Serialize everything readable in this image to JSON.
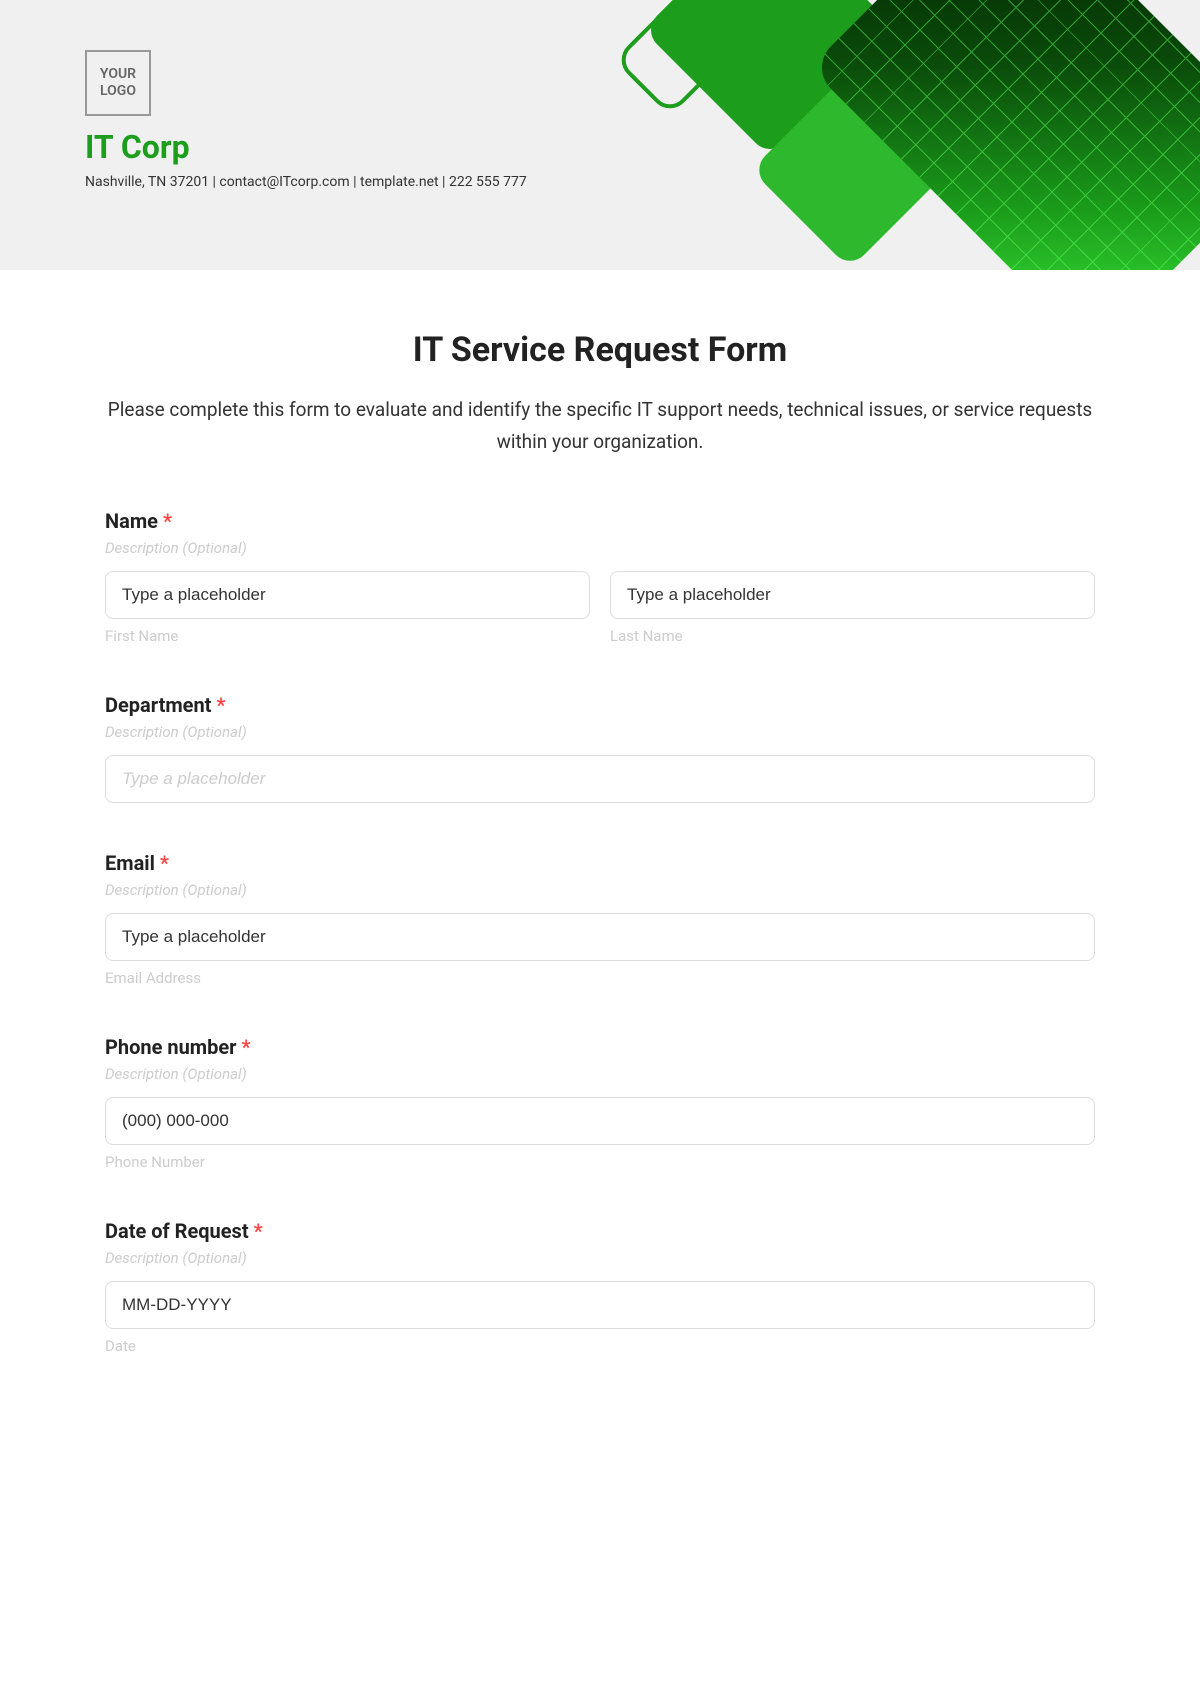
{
  "header": {
    "logo_text": "YOUR LOGO",
    "company_name": "IT Corp",
    "company_info": "Nashville, TN 37201 | contact@ITcorp.com | template.net | 222 555 777"
  },
  "form": {
    "title": "IT Service Request Form",
    "description": "Please complete this form to evaluate and identify the specific IT support needs, technical issues, or service requests within your organization.",
    "fields": {
      "name": {
        "label": "Name",
        "required": "*",
        "desc": "Description (Optional)",
        "first_placeholder": "Type a placeholder",
        "first_sub": "First Name",
        "last_placeholder": "Type a placeholder",
        "last_sub": "Last Name"
      },
      "department": {
        "label": "Department",
        "required": "*",
        "desc": "Description (Optional)",
        "placeholder": "Type a placeholder"
      },
      "email": {
        "label": "Email",
        "required": "*",
        "desc": "Description (Optional)",
        "placeholder": "Type a placeholder",
        "sub": "Email Address"
      },
      "phone": {
        "label": "Phone number",
        "required": "*",
        "desc": "Description (Optional)",
        "placeholder": "(000) 000-000",
        "sub": "Phone Number"
      },
      "date": {
        "label": "Date of Request",
        "required": "*",
        "desc": "Description (Optional)",
        "placeholder": "MM-DD-YYYY",
        "sub": "Date"
      }
    }
  }
}
